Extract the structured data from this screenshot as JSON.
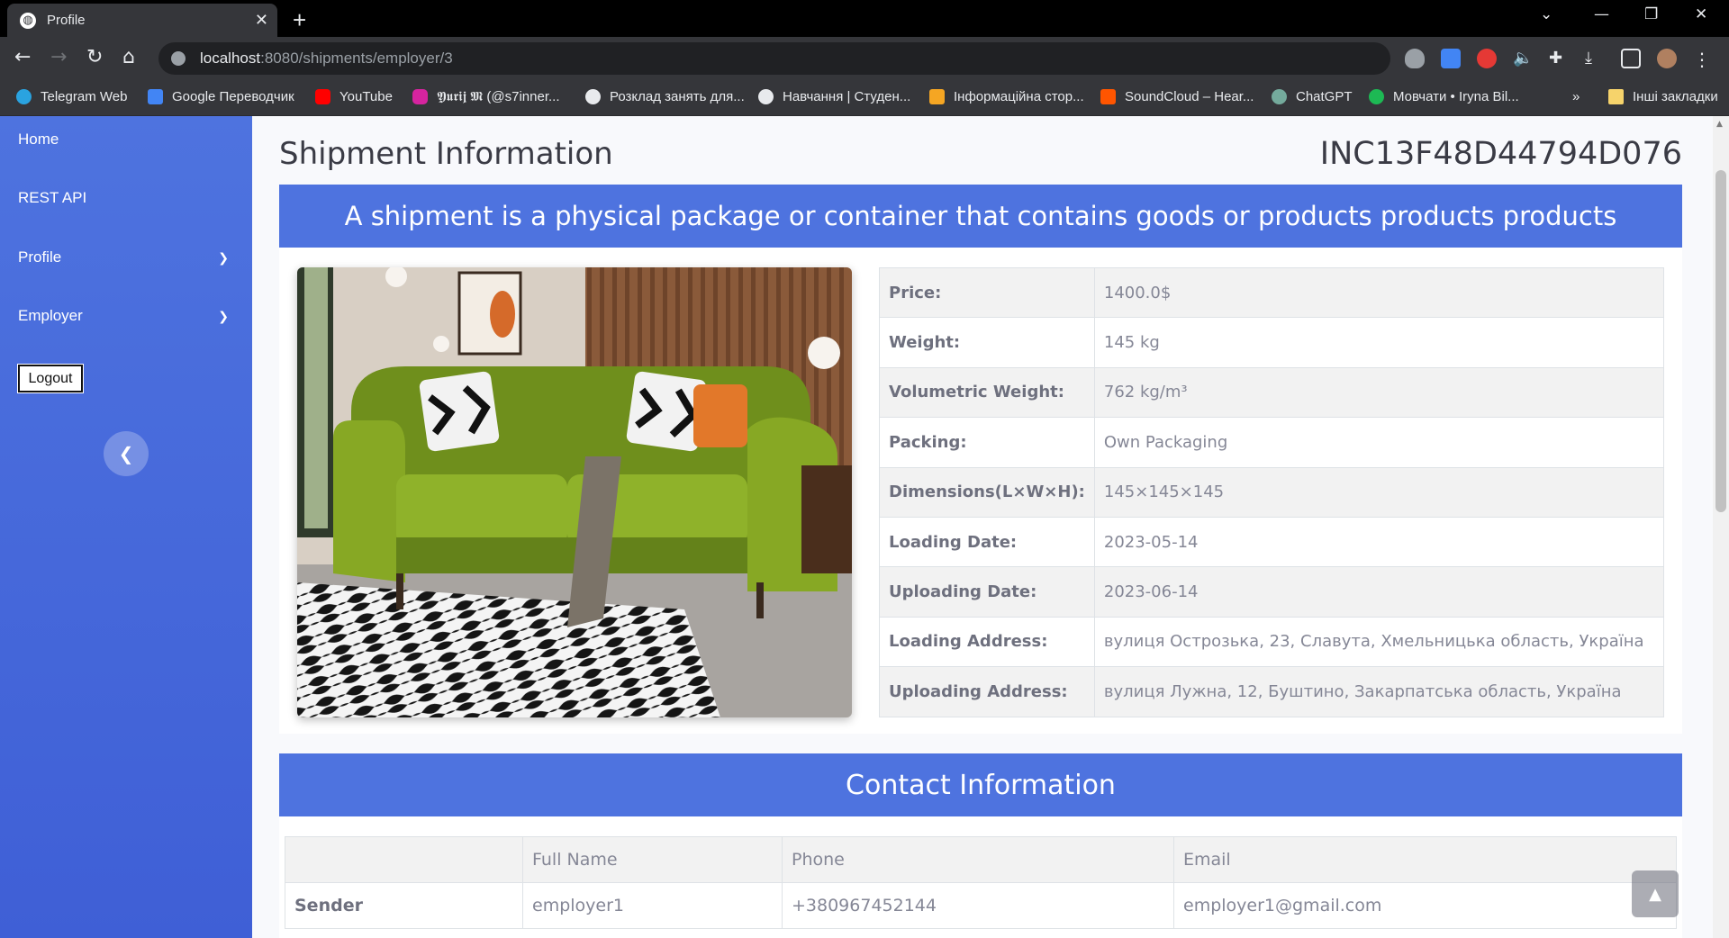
{
  "browser": {
    "tab_title": "Profile",
    "url_host": "localhost",
    "url_path": ":8080/shipments/employer/3",
    "bookmarks": [
      {
        "label": "Telegram Web",
        "color": "#2aa3e0"
      },
      {
        "label": "Google Переводчик",
        "color": "#4285f4"
      },
      {
        "label": "YouTube",
        "color": "#ff0000"
      },
      {
        "label": "𝖄𝖚𝖗𝖎𝖏 𝕸 (@s7inner...",
        "color": "#d6249f"
      },
      {
        "label": "Розклад занять для...",
        "color": "#e8eaed"
      },
      {
        "label": "Навчання | Студен...",
        "color": "#e8eaed"
      },
      {
        "label": "Інформаційна стор...",
        "color": "#f5a623"
      },
      {
        "label": "SoundCloud – Hear...",
        "color": "#ff5500"
      },
      {
        "label": "ChatGPT",
        "color": "#74aa9c"
      },
      {
        "label": "Мовчати • Iryna Bil...",
        "color": "#1db954"
      }
    ],
    "more_bookmarks": "»",
    "other_bookmarks": "Інші закладки"
  },
  "sidebar": {
    "items": [
      {
        "label": "Home"
      },
      {
        "label": "REST API"
      },
      {
        "label": "Profile"
      },
      {
        "label": "Employer"
      }
    ],
    "logout_label": "Logout"
  },
  "page": {
    "title": "Shipment Information",
    "shipment_id": "INC13F48D44794D076",
    "description": "A shipment is a physical package or container that contains goods or products products products",
    "details": [
      {
        "label": "Price:",
        "value": "1400.0$"
      },
      {
        "label": "Weight:",
        "value": "145 kg"
      },
      {
        "label": "Volumetric Weight:",
        "value": "762 kg/m³"
      },
      {
        "label": "Packing:",
        "value": "Own Packaging"
      },
      {
        "label": "Dimensions(L×W×H):",
        "value": "145×145×145"
      },
      {
        "label": "Loading Date:",
        "value": "2023-05-14"
      },
      {
        "label": "Uploading Date:",
        "value": "2023-06-14"
      },
      {
        "label": "Loading Address:",
        "value": "вулиця Острозька, 23, Славута, Хмельницька область, Україна"
      },
      {
        "label": "Uploading Address:",
        "value": "вулиця Лужна, 12, Буштино, Закарпатська область, Україна"
      }
    ],
    "contact_title": "Contact Information",
    "contact_headers": [
      "",
      "Full Name",
      "Phone",
      "Email"
    ],
    "contacts": [
      {
        "role": "Sender",
        "name": "employer1",
        "phone": "+380967452144",
        "email": "employer1@gmail.com"
      }
    ]
  },
  "colors": {
    "primary": "#4e73df",
    "sofa": "#7a9a1e"
  }
}
